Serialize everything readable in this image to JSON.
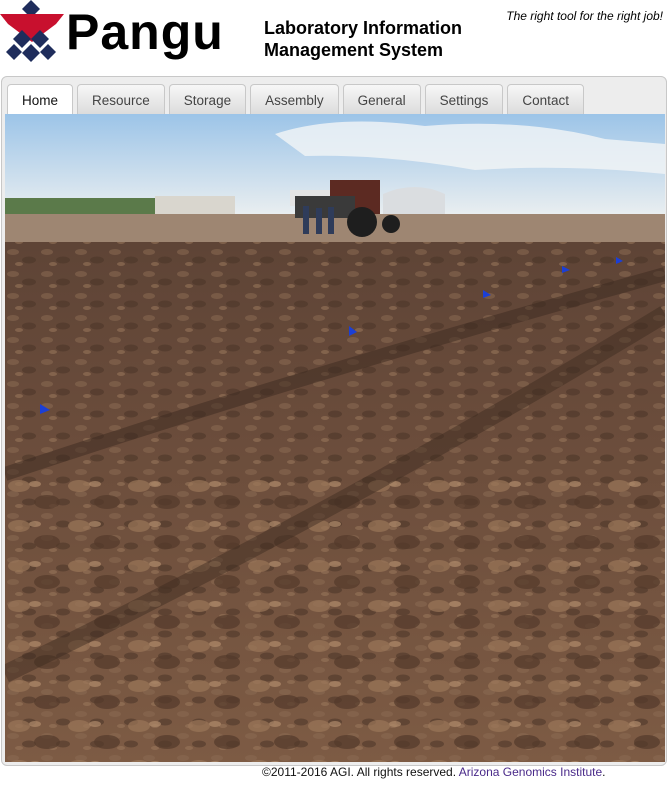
{
  "brand": {
    "logo_text": "Pangu",
    "system_title_line1": "Laboratory Information",
    "system_title_line2": "Management System",
    "tagline": "The right tool for the right job!"
  },
  "tabs": [
    {
      "label": "Home",
      "active": true
    },
    {
      "label": "Resource",
      "active": false
    },
    {
      "label": "Storage",
      "active": false
    },
    {
      "label": "Assembly",
      "active": false
    },
    {
      "label": "General",
      "active": false
    },
    {
      "label": "Settings",
      "active": false
    },
    {
      "label": "Contact",
      "active": false
    }
  ],
  "footer": {
    "copyright": "©2011-2016 AGI. All rights reserved.",
    "link_text": "Arizona Genomics Institute",
    "end": "."
  },
  "colors": {
    "logo_red": "#c8102e",
    "logo_navy": "#1f2d5c",
    "link": "#4a2a8a"
  }
}
